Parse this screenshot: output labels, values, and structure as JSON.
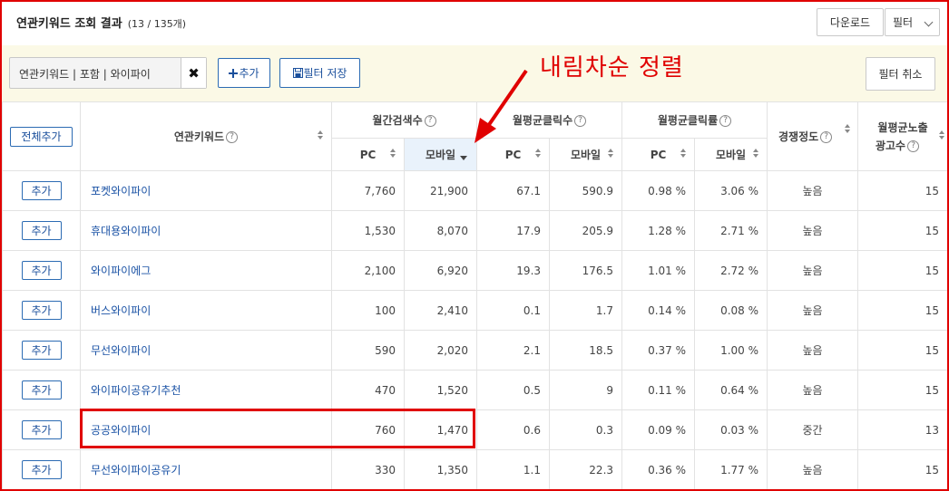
{
  "header": {
    "title": "연관키워드 조회 결과",
    "count": "(13 / 135개)",
    "download_label": "다운로드",
    "filter_label": "필터"
  },
  "filterbar": {
    "chip_text": "연관키워드 | 포함 | 와이파이",
    "chip_remove": "✖",
    "add_label": "추가",
    "save_label": "필터 저장",
    "cancel_label": "필터 취소"
  },
  "annotation": {
    "text": "내림차순 정렬",
    "color": "#e00000"
  },
  "table": {
    "all_add_label": "전체추가",
    "col_keyword": "연관키워드",
    "group_search": "월간검색수",
    "group_clicks": "월평균클릭수",
    "group_ctr": "월평균클릭률",
    "col_competition": "경쟁정도",
    "col_ads_line1": "월평균노출",
    "col_ads_line2": "광고수",
    "sub_pc": "PC",
    "sub_mobile": "모바일",
    "help_glyph": "?",
    "row_add_label": "추가",
    "rows": [
      {
        "keyword": "포켓와이파이",
        "search_pc": "7,760",
        "search_mobile": "21,900",
        "click_pc": "67.1",
        "click_mobile": "590.9",
        "ctr_pc": "0.98 %",
        "ctr_mobile": "3.06 %",
        "competition": "높음",
        "ads": "15"
      },
      {
        "keyword": "휴대용와이파이",
        "search_pc": "1,530",
        "search_mobile": "8,070",
        "click_pc": "17.9",
        "click_mobile": "205.9",
        "ctr_pc": "1.28 %",
        "ctr_mobile": "2.71 %",
        "competition": "높음",
        "ads": "15"
      },
      {
        "keyword": "와이파이에그",
        "search_pc": "2,100",
        "search_mobile": "6,920",
        "click_pc": "19.3",
        "click_mobile": "176.5",
        "ctr_pc": "1.01 %",
        "ctr_mobile": "2.72 %",
        "competition": "높음",
        "ads": "15"
      },
      {
        "keyword": "버스와이파이",
        "search_pc": "100",
        "search_mobile": "2,410",
        "click_pc": "0.1",
        "click_mobile": "1.7",
        "ctr_pc": "0.14 %",
        "ctr_mobile": "0.08 %",
        "competition": "높음",
        "ads": "15"
      },
      {
        "keyword": "무선와이파이",
        "search_pc": "590",
        "search_mobile": "2,020",
        "click_pc": "2.1",
        "click_mobile": "18.5",
        "ctr_pc": "0.37 %",
        "ctr_mobile": "1.00 %",
        "competition": "높음",
        "ads": "15"
      },
      {
        "keyword": "와이파이공유기추천",
        "search_pc": "470",
        "search_mobile": "1,520",
        "click_pc": "0.5",
        "click_mobile": "9",
        "ctr_pc": "0.11 %",
        "ctr_mobile": "0.64 %",
        "competition": "높음",
        "ads": "15"
      },
      {
        "keyword": "공공와이파이",
        "search_pc": "760",
        "search_mobile": "1,470",
        "click_pc": "0.6",
        "click_mobile": "0.3",
        "ctr_pc": "0.09 %",
        "ctr_mobile": "0.03 %",
        "competition": "중간",
        "ads": "13"
      },
      {
        "keyword": "무선와이파이공유기",
        "search_pc": "330",
        "search_mobile": "1,350",
        "click_pc": "1.1",
        "click_mobile": "22.3",
        "ctr_pc": "0.36 %",
        "ctr_mobile": "1.77 %",
        "competition": "높음",
        "ads": "15"
      }
    ]
  },
  "icons": {
    "add": "plus-icon",
    "save": "save-icon",
    "remove": "close-icon",
    "help": "help-icon",
    "sort": "sort-icon",
    "dropdown": "chevron-down-icon"
  }
}
